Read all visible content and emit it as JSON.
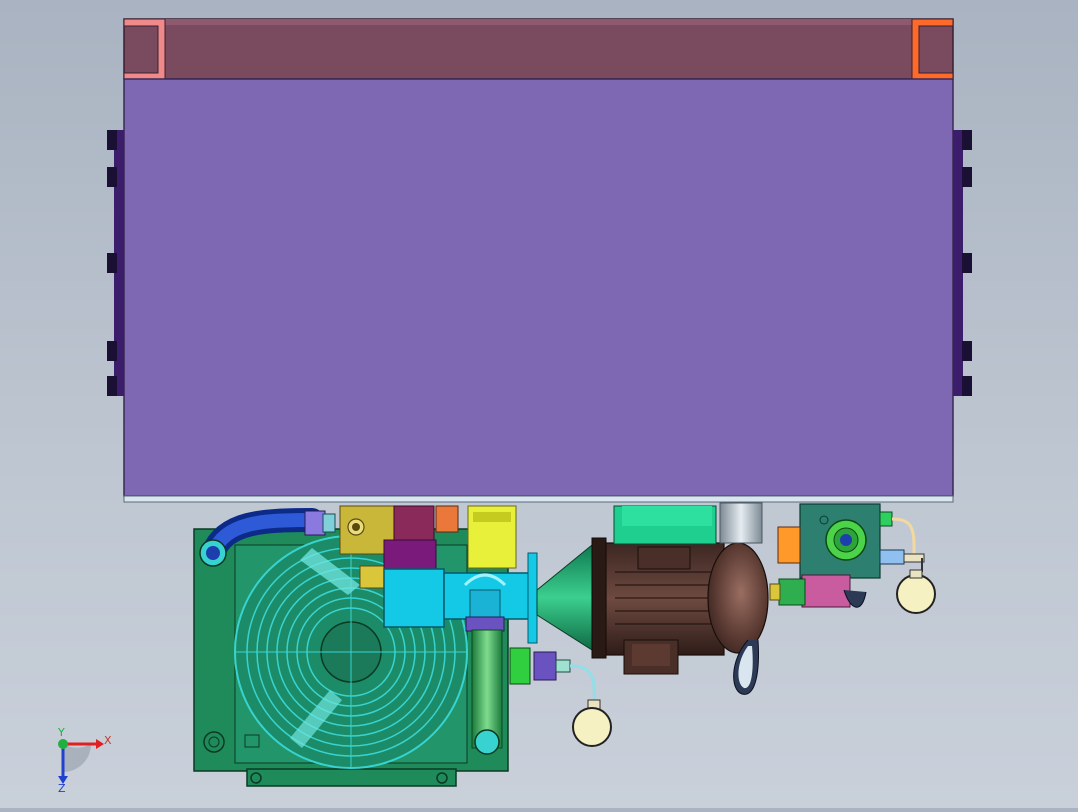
{
  "viewport": {
    "background_top": "#a9b3c1",
    "background_bottom": "#c9d0da"
  },
  "model": {
    "tank_color": "#7e67b3",
    "tank_top_color": "#7a4a5e",
    "bracket_left_color": "#f08a8a",
    "bracket_right_color": "#ff6a2a",
    "cooler_frame_color": "#1f8a5a",
    "fan_grill_color": "#38d3d0",
    "motor_color": "#5a3a32",
    "bellhousing_color": "#2fae7a",
    "coupling_color": "#13c9e6",
    "hose_color": "#1d3fae",
    "valve_block_color": "#2d7f6f",
    "solenoid_color": "#c95b9f",
    "gauge_color": "#f6f1c2"
  },
  "triad": {
    "x_label": "X",
    "y_label": "Y",
    "z_label": "Z",
    "x_color": "#e02020",
    "y_color": "#20b040",
    "z_color": "#2040d0"
  }
}
